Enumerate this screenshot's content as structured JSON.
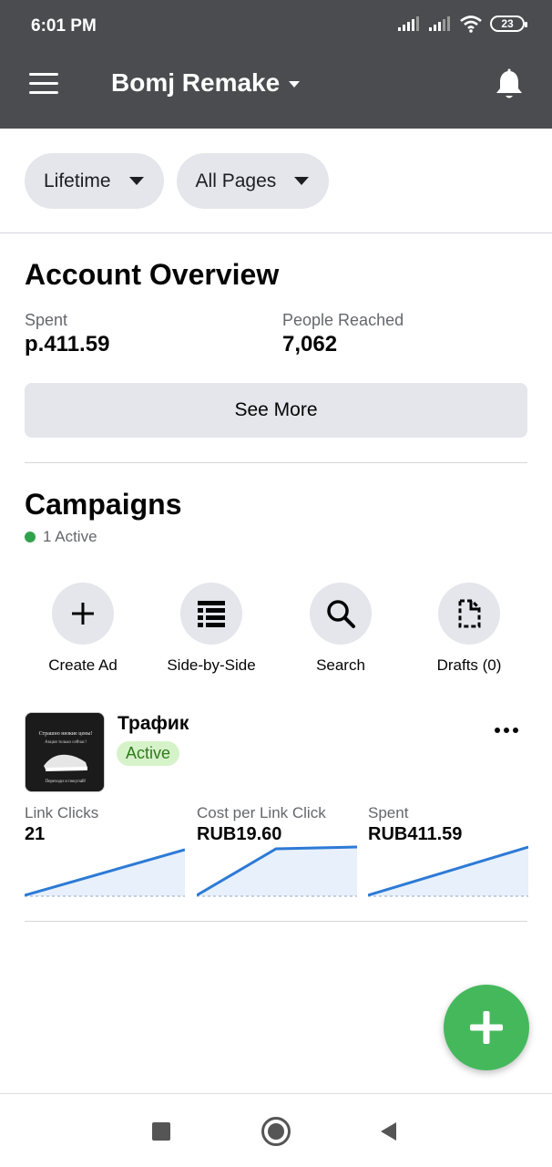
{
  "status_bar": {
    "time": "6:01 PM",
    "battery": "23"
  },
  "header": {
    "account_name": "Bomj Remake"
  },
  "filters": {
    "date_range": "Lifetime",
    "pages": "All Pages"
  },
  "overview": {
    "title": "Account Overview",
    "spent_label": "Spent",
    "spent_value": "р.411.59",
    "reached_label": "People Reached",
    "reached_value": "7,062",
    "see_more": "See More"
  },
  "campaigns": {
    "title": "Campaigns",
    "active_count": "1 Active",
    "actions": [
      {
        "label": "Create Ad",
        "icon": "plus-icon"
      },
      {
        "label": "Side-by-Side",
        "icon": "side-by-side-icon"
      },
      {
        "label": "Search",
        "icon": "search-icon"
      },
      {
        "label": "Drafts (0)",
        "icon": "drafts-icon"
      }
    ],
    "campaign": {
      "name": "Трафик",
      "status": "Active",
      "thumb_text_top": "Страшно низкие цены!",
      "thumb_text_mid": "Акция только сейчас!",
      "thumb_text_bottom": "Переходи и покупай!"
    },
    "stats": [
      {
        "label": "Link Clicks",
        "value": "21"
      },
      {
        "label": "Cost per Link Click",
        "value": "RUB19.60"
      },
      {
        "label": "Spent",
        "value": "RUB411.59"
      }
    ]
  },
  "colors": {
    "header_bg": "#4b4c4f",
    "active_green": "#31a24c",
    "fab_green": "#45b85c",
    "spark_line": "#2d7ad6",
    "spark_fill": "#e7f0fb"
  }
}
